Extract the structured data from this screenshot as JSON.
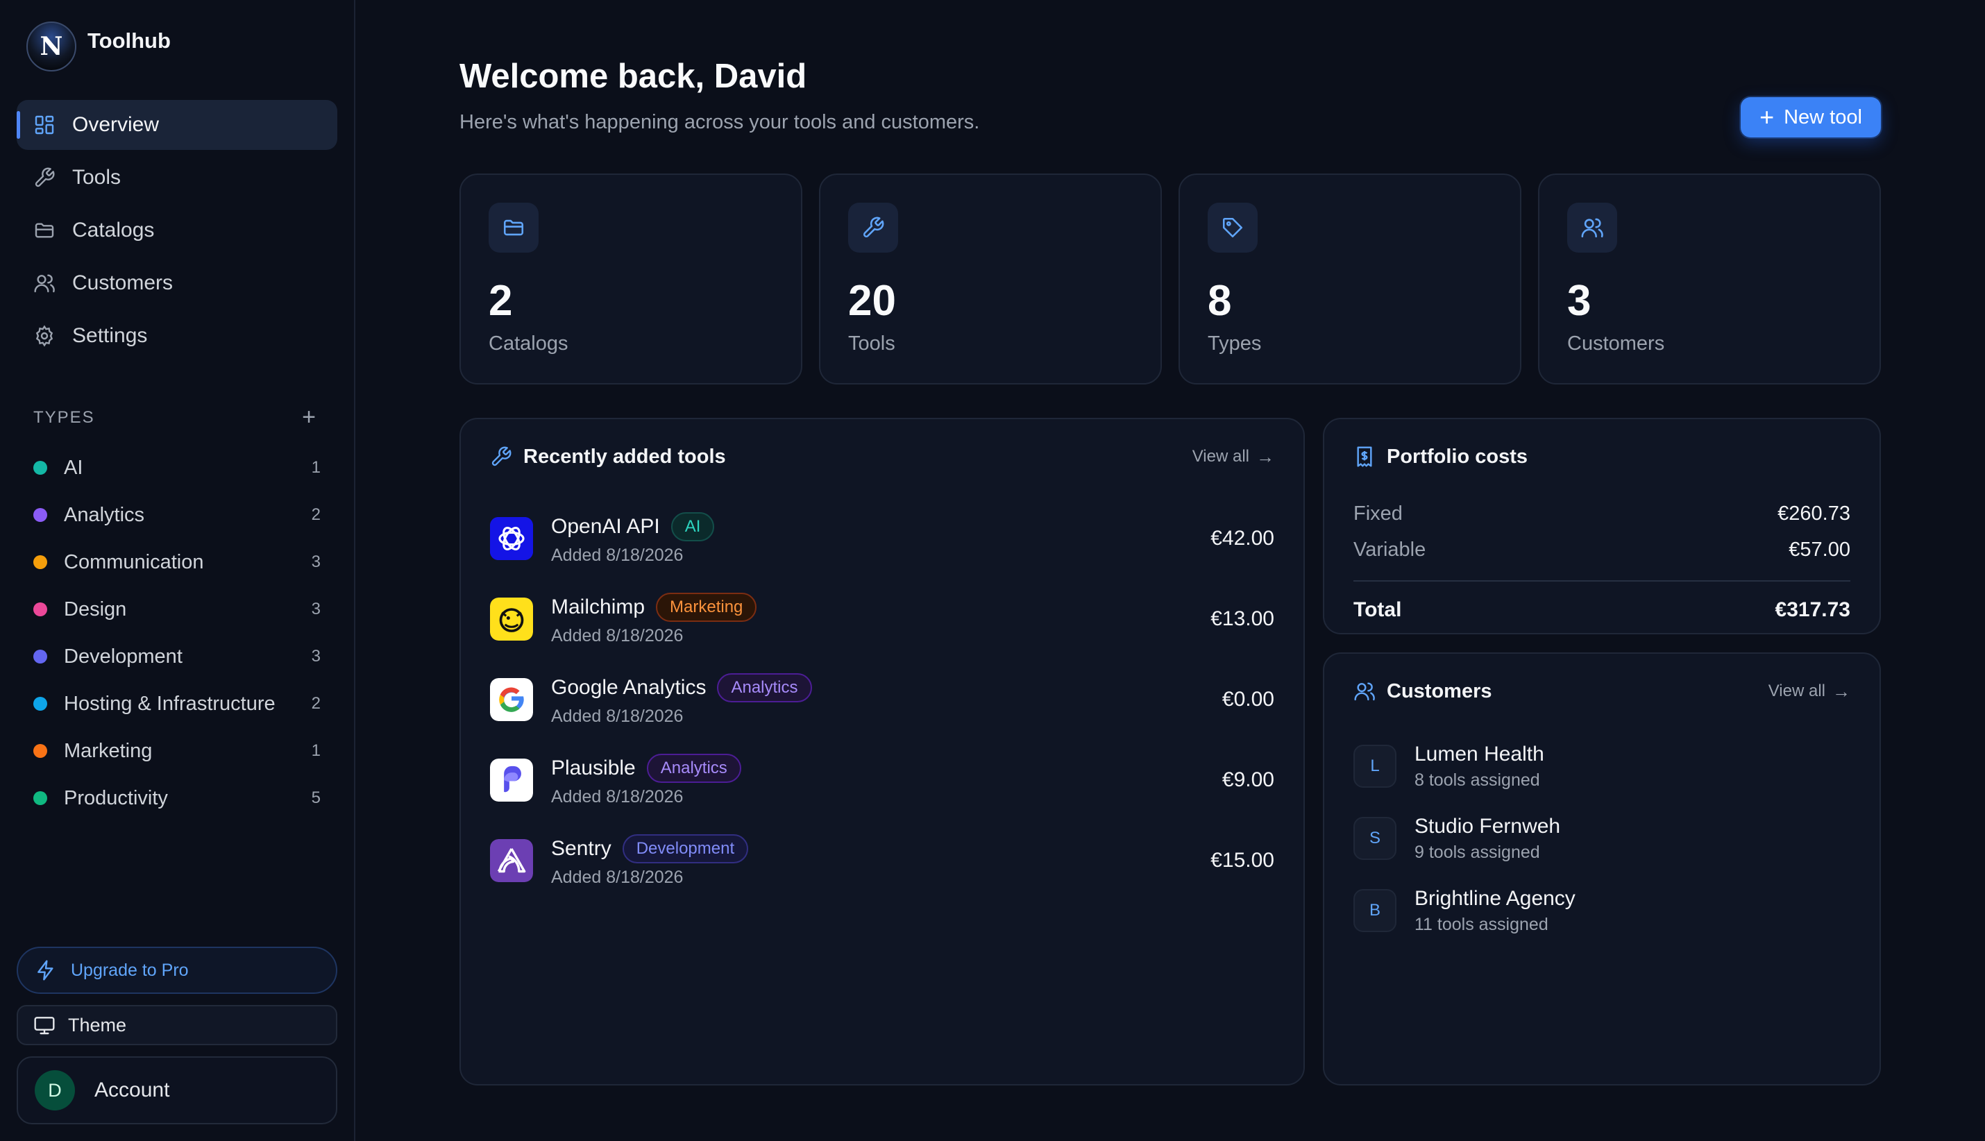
{
  "app": {
    "name": "Toolhub",
    "logo_letter": "N"
  },
  "sidebar": {
    "nav": [
      {
        "label": "Overview",
        "icon": "grid-icon",
        "active": true
      },
      {
        "label": "Tools",
        "icon": "wrench-icon"
      },
      {
        "label": "Catalogs",
        "icon": "folder-icon"
      },
      {
        "label": "Customers",
        "icon": "users-icon"
      },
      {
        "label": "Settings",
        "icon": "gear-icon"
      }
    ],
    "types_heading": "TYPES",
    "types": [
      {
        "label": "AI",
        "count": "1",
        "color": "#14b8a6"
      },
      {
        "label": "Analytics",
        "count": "2",
        "color": "#8b5cf6"
      },
      {
        "label": "Communication",
        "count": "3",
        "color": "#f59e0b"
      },
      {
        "label": "Design",
        "count": "3",
        "color": "#ec4899"
      },
      {
        "label": "Development",
        "count": "3",
        "color": "#6366f1"
      },
      {
        "label": "Hosting & Infrastructure",
        "count": "2",
        "color": "#0ea5e9"
      },
      {
        "label": "Marketing",
        "count": "1",
        "color": "#f97316"
      },
      {
        "label": "Productivity",
        "count": "5",
        "color": "#10b981"
      }
    ],
    "upgrade_label": "Upgrade to Pro",
    "theme_label": "Theme",
    "account": {
      "label": "Account",
      "initial": "D"
    }
  },
  "header": {
    "title": "Welcome back, David",
    "subtitle": "Here's what's happening across your tools and customers.",
    "new_tool_label": "New tool"
  },
  "stats": [
    {
      "value": "2",
      "label": "Catalogs",
      "icon": "folder-icon"
    },
    {
      "value": "20",
      "label": "Tools",
      "icon": "wrench-icon"
    },
    {
      "value": "8",
      "label": "Types",
      "icon": "tag-icon"
    },
    {
      "value": "3",
      "label": "Customers",
      "icon": "users-icon"
    }
  ],
  "recent": {
    "title": "Recently added tools",
    "view_all": "View all",
    "tools": [
      {
        "name": "OpenAI API",
        "badge": "AI",
        "badge_color": "#14b8a6",
        "added": "Added 8/18/2026",
        "price": "€42.00",
        "logo": "openai-logo"
      },
      {
        "name": "Mailchimp",
        "badge": "Marketing",
        "badge_color": "#f97316",
        "added": "Added 8/18/2026",
        "price": "€13.00",
        "logo": "mailchimp-logo"
      },
      {
        "name": "Google Analytics",
        "badge": "Analytics",
        "badge_color": "#8b5cf6",
        "added": "Added 8/18/2026",
        "price": "€0.00",
        "logo": "google-logo"
      },
      {
        "name": "Plausible",
        "badge": "Analytics",
        "badge_color": "#8b5cf6",
        "added": "Added 8/18/2026",
        "price": "€9.00",
        "logo": "plausible-logo"
      },
      {
        "name": "Sentry",
        "badge": "Development",
        "badge_color": "#6366f1",
        "added": "Added 8/18/2026",
        "price": "€15.00",
        "logo": "sentry-logo"
      }
    ]
  },
  "costs": {
    "title": "Portfolio costs",
    "fixed_label": "Fixed",
    "fixed_value": "€260.73",
    "variable_label": "Variable",
    "variable_value": "€57.00",
    "total_label": "Total",
    "total_value": "€317.73"
  },
  "customers": {
    "title": "Customers",
    "view_all": "View all",
    "list": [
      {
        "initial": "L",
        "name": "Lumen Health",
        "sub": "8 tools assigned"
      },
      {
        "initial": "S",
        "name": "Studio Fernweh",
        "sub": "9 tools assigned"
      },
      {
        "initial": "B",
        "name": "Brightline Agency",
        "sub": "11 tools assigned"
      }
    ]
  },
  "colors": {
    "accent": "#3b82f6",
    "background": "#0b0f1a",
    "card": "#0f1524"
  }
}
